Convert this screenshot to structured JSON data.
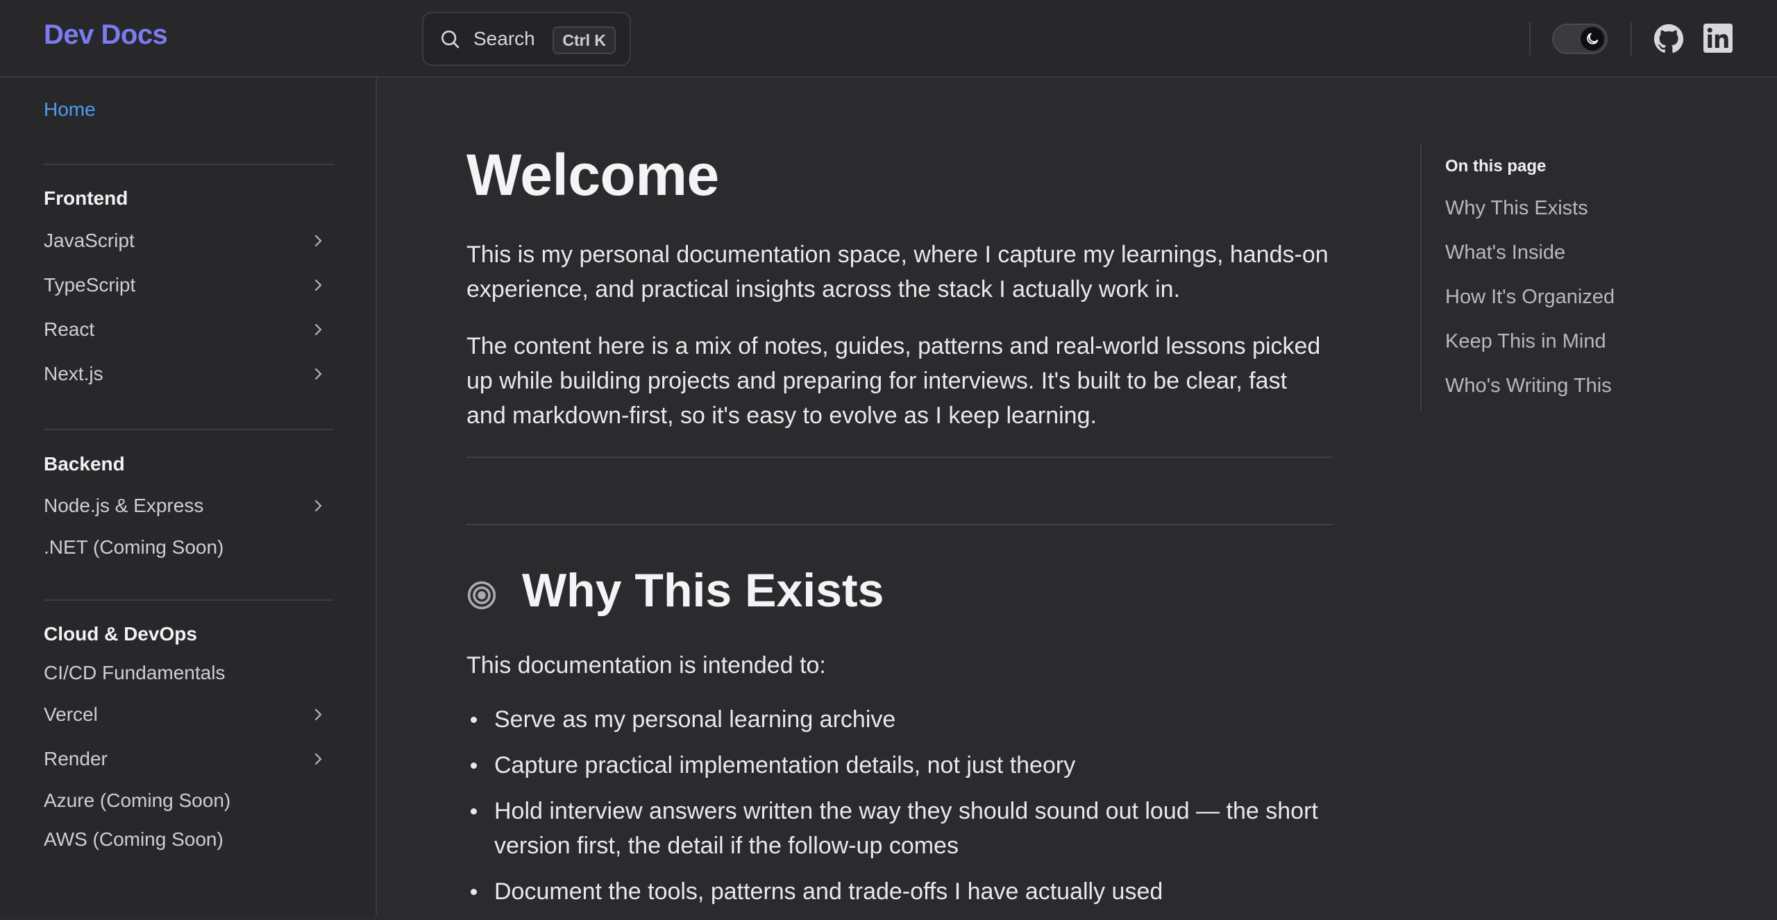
{
  "header": {
    "brand": "Dev Docs",
    "search_label": "Search",
    "search_shortcut": "Ctrl K",
    "theme": "dark",
    "icons": [
      "search-icon",
      "moon-icon",
      "github-icon",
      "linkedin-icon"
    ]
  },
  "sidebar": {
    "home": "Home",
    "groups": [
      {
        "title": "Frontend",
        "items": [
          {
            "label": "JavaScript",
            "expandable": true
          },
          {
            "label": "TypeScript",
            "expandable": true
          },
          {
            "label": "React",
            "expandable": true
          },
          {
            "label": "Next.js",
            "expandable": true
          }
        ]
      },
      {
        "title": "Backend",
        "items": [
          {
            "label": "Node.js & Express",
            "expandable": true
          },
          {
            "label": ".NET (Coming Soon)",
            "expandable": false
          }
        ]
      },
      {
        "title": "Cloud & DevOps",
        "items": [
          {
            "label": "CI/CD Fundamentals",
            "expandable": false
          },
          {
            "label": "Vercel",
            "expandable": true
          },
          {
            "label": "Render",
            "expandable": true
          },
          {
            "label": "Azure (Coming Soon)",
            "expandable": false
          },
          {
            "label": "AWS (Coming Soon)",
            "expandable": false
          }
        ]
      }
    ]
  },
  "main": {
    "title": "Welcome",
    "intro": [
      "This is my personal documentation space, where I capture my learnings, hands-on experience, and practical insights across the stack I actually work in.",
      "The content here is a mix of notes, guides, patterns and real-world lessons picked up while building projects and preparing for interviews. It's built to be clear, fast and markdown-first, so it's easy to evolve as I keep learning."
    ],
    "section": {
      "heading": "Why This Exists",
      "icon": "target-icon",
      "lead": "This documentation is intended to:",
      "bullets": [
        "Serve as my personal learning archive",
        "Capture practical implementation details, not just theory",
        "Hold interview answers written the way they should sound out loud — the short version first, the detail if the follow-up comes",
        "Document the tools, patterns and trade-offs I have actually used"
      ]
    }
  },
  "toc": {
    "title": "On this page",
    "items": [
      "Why This Exists",
      "What's Inside",
      "How It's Organized",
      "Keep This in Mind",
      "Who's Writing This"
    ]
  },
  "colors": {
    "background": "#2b2b2e",
    "brand": "#7b7cf0",
    "active_link": "#4d9cf0",
    "text": "#e9e9ec",
    "muted": "#b8b8bd"
  }
}
